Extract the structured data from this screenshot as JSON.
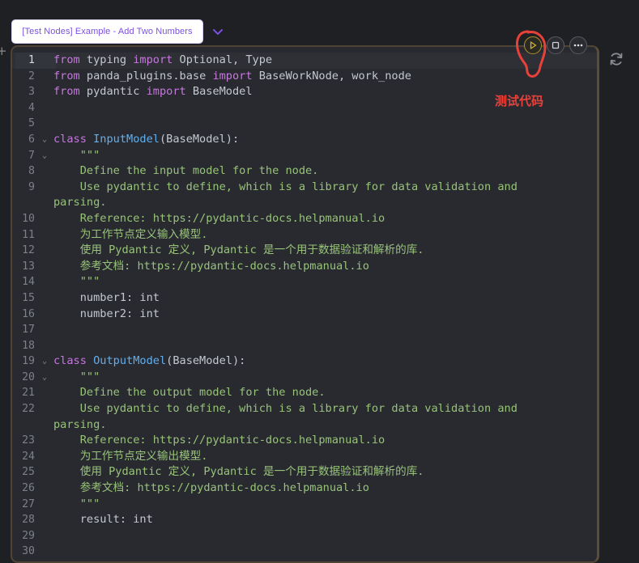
{
  "node": {
    "title": "[Test Nodes] Example - Add Two Numbers"
  },
  "toolbar": {
    "run_icon": "play-icon",
    "stop_icon": "stop-icon",
    "more_icon": "ellipsis-icon",
    "refresh_icon": "refresh-icon",
    "run_accent": "#d4b030"
  },
  "annotation": {
    "label": "测试代码",
    "color": "#e8413a"
  },
  "editor": {
    "active_line": 1,
    "lines": [
      {
        "n": "1",
        "fold": false,
        "parts": [
          [
            "kw",
            "from"
          ],
          [
            "plain",
            " typing "
          ],
          [
            "kw",
            "import"
          ],
          [
            "plain",
            " Optional, Type"
          ]
        ]
      },
      {
        "n": "2",
        "fold": false,
        "parts": [
          [
            "kw",
            "from"
          ],
          [
            "plain",
            " panda_plugins.base "
          ],
          [
            "kw",
            "import"
          ],
          [
            "plain",
            " BaseWorkNode, work_node"
          ]
        ]
      },
      {
        "n": "3",
        "fold": false,
        "parts": [
          [
            "kw",
            "from"
          ],
          [
            "plain",
            " pydantic "
          ],
          [
            "kw",
            "import"
          ],
          [
            "plain",
            " BaseModel"
          ]
        ]
      },
      {
        "n": "4",
        "fold": false,
        "parts": []
      },
      {
        "n": "5",
        "fold": false,
        "parts": []
      },
      {
        "n": "6",
        "fold": true,
        "parts": [
          [
            "kw",
            "class"
          ],
          [
            "plain",
            " "
          ],
          [
            "cls",
            "InputModel"
          ],
          [
            "plain",
            "(BaseModel):"
          ]
        ]
      },
      {
        "n": "7",
        "fold": true,
        "parts": [
          [
            "str",
            "    \"\"\""
          ]
        ]
      },
      {
        "n": "8",
        "fold": false,
        "parts": [
          [
            "str",
            "    Define the input model for the node."
          ]
        ]
      },
      {
        "n": "9",
        "fold": false,
        "parts": [
          [
            "str",
            "    Use pydantic to define, which is a library for data validation and"
          ]
        ]
      },
      {
        "n": "",
        "fold": false,
        "parts": [
          [
            "str",
            "parsing."
          ]
        ]
      },
      {
        "n": "10",
        "fold": false,
        "parts": [
          [
            "str",
            "    Reference: https://pydantic-docs.helpmanual.io"
          ]
        ]
      },
      {
        "n": "11",
        "fold": false,
        "parts": [
          [
            "str",
            "    为工作节点定义输入模型."
          ]
        ]
      },
      {
        "n": "12",
        "fold": false,
        "parts": [
          [
            "str",
            "    使用 Pydantic 定义, Pydantic 是一个用于数据验证和解析的库."
          ]
        ]
      },
      {
        "n": "13",
        "fold": false,
        "parts": [
          [
            "str",
            "    参考文档: https://pydantic-docs.helpmanual.io"
          ]
        ]
      },
      {
        "n": "14",
        "fold": false,
        "parts": [
          [
            "str",
            "    \"\"\""
          ]
        ]
      },
      {
        "n": "15",
        "fold": false,
        "parts": [
          [
            "plain",
            "    number1: int"
          ]
        ]
      },
      {
        "n": "16",
        "fold": false,
        "parts": [
          [
            "plain",
            "    number2: int"
          ]
        ]
      },
      {
        "n": "17",
        "fold": false,
        "parts": []
      },
      {
        "n": "18",
        "fold": false,
        "parts": []
      },
      {
        "n": "19",
        "fold": true,
        "parts": [
          [
            "kw",
            "class"
          ],
          [
            "plain",
            " "
          ],
          [
            "cls",
            "OutputModel"
          ],
          [
            "plain",
            "(BaseModel):"
          ]
        ]
      },
      {
        "n": "20",
        "fold": true,
        "parts": [
          [
            "str",
            "    \"\"\""
          ]
        ]
      },
      {
        "n": "21",
        "fold": false,
        "parts": [
          [
            "str",
            "    Define the output model for the node."
          ]
        ]
      },
      {
        "n": "22",
        "fold": false,
        "parts": [
          [
            "str",
            "    Use pydantic to define, which is a library for data validation and"
          ]
        ]
      },
      {
        "n": "",
        "fold": false,
        "parts": [
          [
            "str",
            "parsing."
          ]
        ]
      },
      {
        "n": "23",
        "fold": false,
        "parts": [
          [
            "str",
            "    Reference: https://pydantic-docs.helpmanual.io"
          ]
        ]
      },
      {
        "n": "24",
        "fold": false,
        "parts": [
          [
            "str",
            "    为工作节点定义输出模型."
          ]
        ]
      },
      {
        "n": "25",
        "fold": false,
        "parts": [
          [
            "str",
            "    使用 Pydantic 定义, Pydantic 是一个用于数据验证和解析的库."
          ]
        ]
      },
      {
        "n": "26",
        "fold": false,
        "parts": [
          [
            "str",
            "    参考文档: https://pydantic-docs.helpmanual.io"
          ]
        ]
      },
      {
        "n": "27",
        "fold": false,
        "parts": [
          [
            "str",
            "    \"\"\""
          ]
        ]
      },
      {
        "n": "28",
        "fold": false,
        "parts": [
          [
            "plain",
            "    result: int"
          ]
        ]
      },
      {
        "n": "29",
        "fold": false,
        "parts": []
      },
      {
        "n": "30",
        "fold": false,
        "parts": []
      }
    ]
  }
}
